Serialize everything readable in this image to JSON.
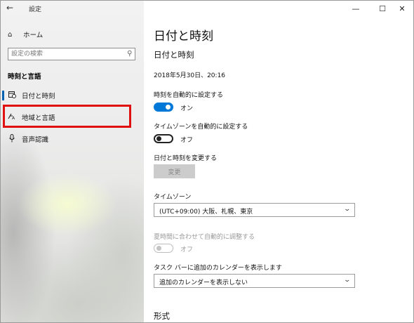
{
  "window": {
    "app_title": "設定",
    "back_glyph": "←",
    "controls": {
      "minimize": "—",
      "maximize": "☐",
      "close": "✕"
    }
  },
  "sidebar": {
    "home_label": "ホーム",
    "search_placeholder": "設定の検索",
    "section_title": "時刻と言語",
    "items": [
      {
        "label": "日付と時刻",
        "icon": "calendar-clock-icon",
        "selected": true
      },
      {
        "label": "地域と言語",
        "icon": "language-icon",
        "selected": false,
        "highlighted": true
      },
      {
        "label": "音声認識",
        "icon": "microphone-icon",
        "selected": false
      }
    ]
  },
  "main": {
    "page_title": "日付と時刻",
    "section_title": "日付と時刻",
    "current_datetime": "2018年5月30日、20:16",
    "auto_time": {
      "label": "時刻を自動的に設定する",
      "state": "オン",
      "on": true
    },
    "auto_timezone": {
      "label": "タイムゾーンを自動的に設定する",
      "state": "オフ",
      "on": false
    },
    "change_datetime": {
      "label": "日付と時刻を変更する",
      "button": "変更"
    },
    "timezone": {
      "label": "タイムゾーン",
      "value": "(UTC+09:00) 大阪、札幌、東京"
    },
    "dst": {
      "label": "夏時間に合わせて自動的に調整する",
      "state": "オフ",
      "enabled": false
    },
    "taskbar_calendar": {
      "label": "タスク バーに追加のカレンダーを表示します",
      "value": "追加のカレンダーを表示しない"
    },
    "format_title": "形式"
  },
  "colors": {
    "accent": "#0078d7",
    "highlight_box": "#e01010"
  }
}
